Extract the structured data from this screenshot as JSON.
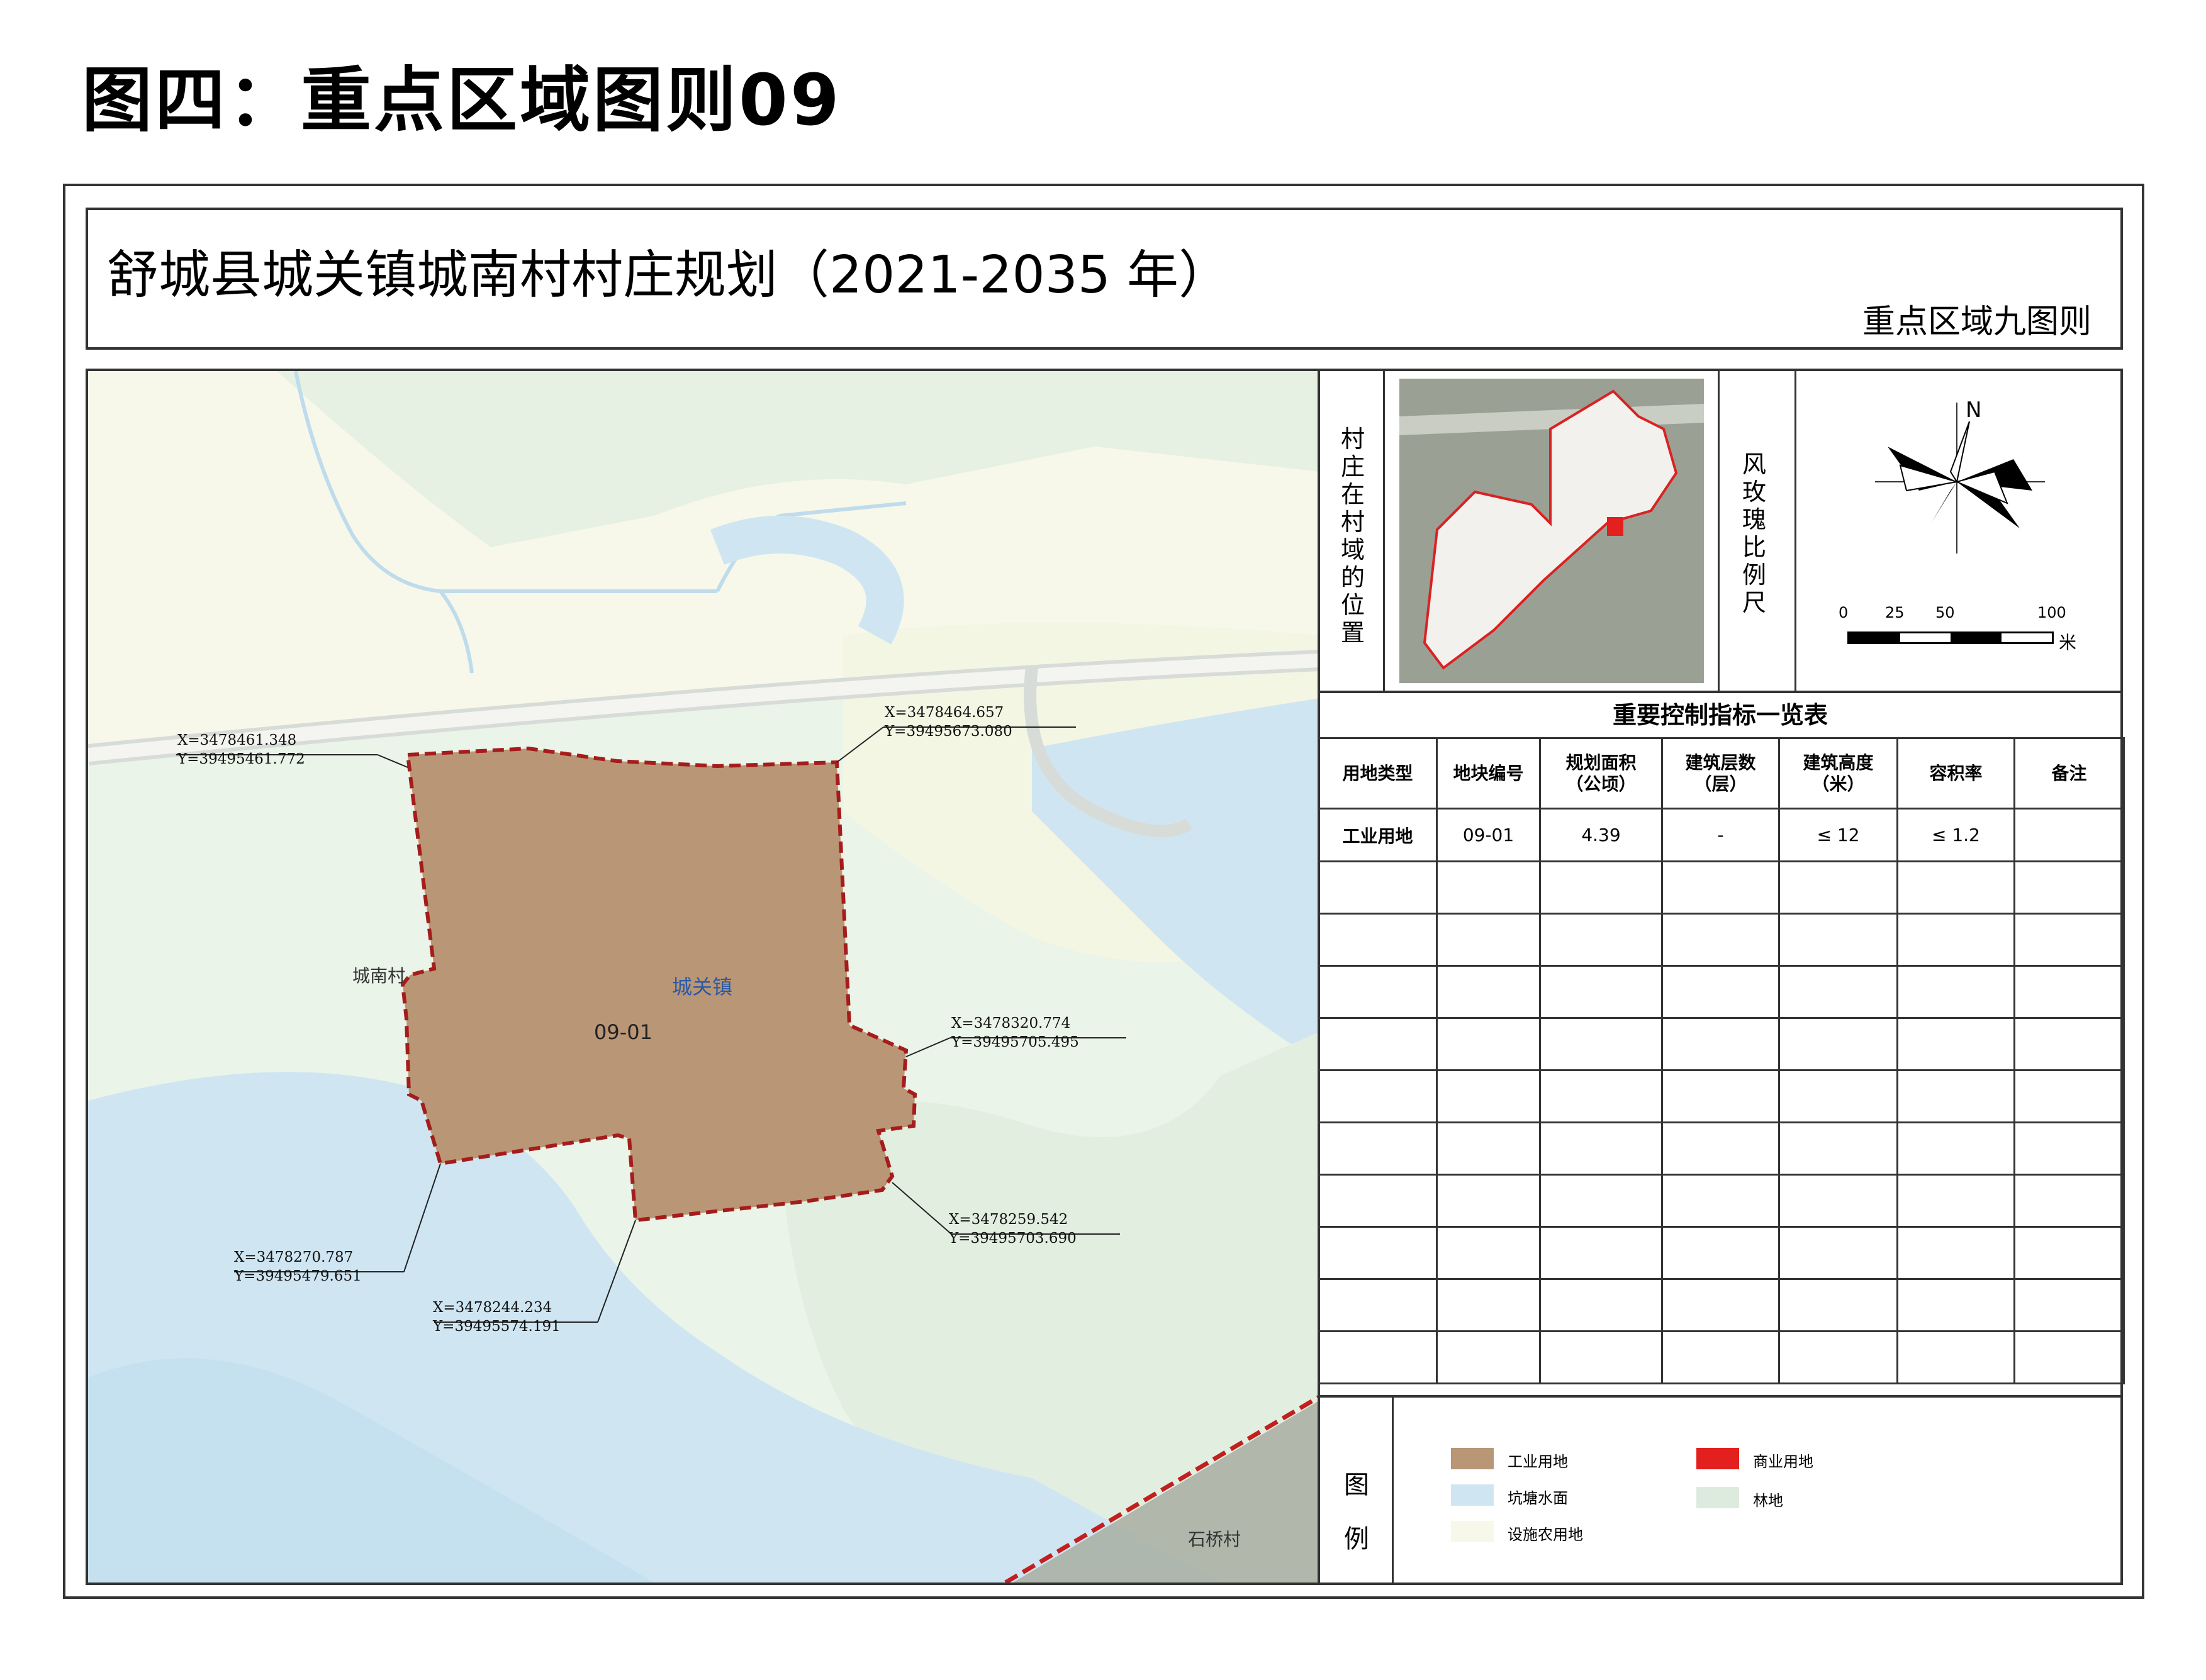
{
  "page_title": "图四：重点区域图则09",
  "plan_title": "舒城县城关镇城南村村庄规划（2021-2035 年）",
  "plan_subtitle": "重点区域九图则",
  "map": {
    "parcel_id": "09-01",
    "town_label": "城关镇",
    "place_labels": [
      "城南村",
      "石桥村"
    ],
    "colors": {
      "parcel_fill": "#b99675",
      "boundary": "#a51c1c",
      "water": "#cfe6f2",
      "forest": "#dcebdd",
      "facility_farmland": "#f7f8ea"
    },
    "coordinates": [
      {
        "x": "X=3478461.348",
        "y": "Y=39495461.772"
      },
      {
        "x": "X=3478464.657",
        "y": "Y=39495673.080"
      },
      {
        "x": "X=3478320.774",
        "y": "Y=39495705.495"
      },
      {
        "x": "X=3478259.542",
        "y": "Y=39495703.690"
      },
      {
        "x": "X=3478270.787",
        "y": "Y=39495479.651"
      },
      {
        "x": "X=3478244.234",
        "y": "Y=39495574.191"
      }
    ]
  },
  "location_panel": {
    "label": "村庄在村域的位置"
  },
  "compass_panel": {
    "label": "风玫瑰比例尺",
    "north": "N",
    "scale_ticks": [
      "0",
      "25",
      "50",
      "100"
    ],
    "scale_unit": "米"
  },
  "indicator_table": {
    "title": "重要控制指标一览表",
    "headers": [
      "用地类型",
      "地块编号",
      "规划面积\n（公顷）",
      "建筑层数\n（层）",
      "建筑高度\n（米）",
      "容积率",
      "备注"
    ],
    "rows": [
      [
        "工业用地",
        "09-01",
        "4.39",
        "-",
        "≤ 12",
        "≤ 1.2",
        ""
      ]
    ],
    "empty_rows": 10
  },
  "legend": {
    "label": "图例",
    "items": [
      {
        "label": "工业用地",
        "color": "#b99675"
      },
      {
        "label": "商业用地",
        "color": "#e3201e"
      },
      {
        "label": "坑塘水面",
        "color": "#cfe6f2"
      },
      {
        "label": "林地",
        "color": "#dcebdd"
      },
      {
        "label": "设施农用地",
        "color": "#f7f8ea"
      }
    ]
  }
}
